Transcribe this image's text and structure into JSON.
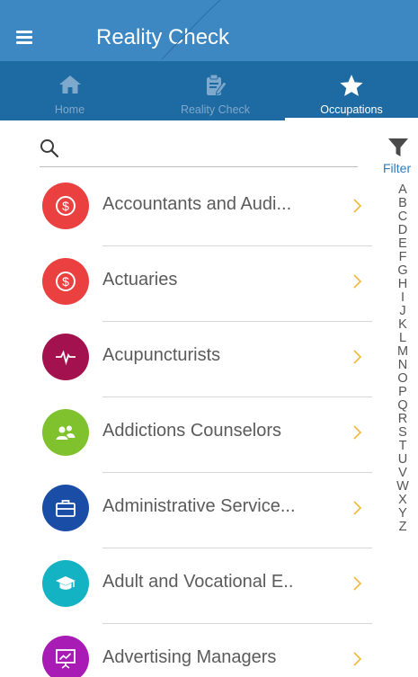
{
  "app": {
    "title": "Reality Check",
    "accent": "#3d88c3",
    "tab_bg": "#1e6aa2"
  },
  "tabs": [
    {
      "label": "Home",
      "icon": "home-icon",
      "active": false
    },
    {
      "label": "Reality Check",
      "icon": "clipboard-edit-icon",
      "active": false
    },
    {
      "label": "Occupations",
      "icon": "star-icon",
      "active": true
    }
  ],
  "search": {
    "value": "",
    "placeholder": "",
    "icon": "search-icon"
  },
  "filter": {
    "label": "Filter",
    "icon": "funnel-icon"
  },
  "alphabet": [
    "A",
    "B",
    "C",
    "D",
    "E",
    "F",
    "G",
    "H",
    "I",
    "J",
    "K",
    "L",
    "M",
    "N",
    "O",
    "P",
    "Q",
    "R",
    "S",
    "T",
    "U",
    "V",
    "W",
    "X",
    "Y",
    "Z"
  ],
  "occupations": [
    {
      "title": "Accountants and Audi...",
      "icon": "dollar-coin-icon",
      "color": "#ea4040"
    },
    {
      "title": "Actuaries",
      "icon": "dollar-coin-icon",
      "color": "#ea4040"
    },
    {
      "title": "Acupuncturists",
      "icon": "heartbeat-icon",
      "color": "#a3114f"
    },
    {
      "title": "Addictions Counselors",
      "icon": "people-icon",
      "color": "#7fc22d"
    },
    {
      "title": "Administrative Service...",
      "icon": "briefcase-icon",
      "color": "#1a4ea6"
    },
    {
      "title": "Adult and Vocational E..",
      "icon": "graduation-cap-icon",
      "color": "#14b3c4"
    },
    {
      "title": "Advertising Managers",
      "icon": "presentation-icon",
      "color": "#a81bb4"
    }
  ],
  "chevron_color": "#f2b83a"
}
